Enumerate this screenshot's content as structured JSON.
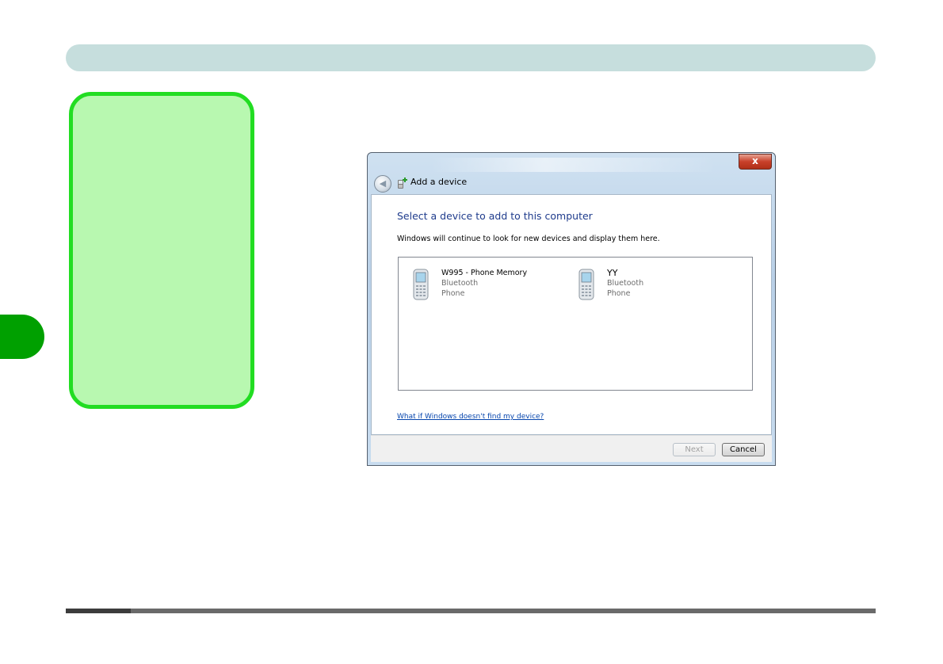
{
  "dialog": {
    "title": "Add a device",
    "close_label": "x",
    "heading": "Select a device to add to this computer",
    "subtext": "Windows will continue to look for new devices and display them here.",
    "devices": [
      {
        "name": "W995 - Phone Memory",
        "connection": "Bluetooth",
        "category": "Phone"
      },
      {
        "name": "YY",
        "connection": "Bluetooth",
        "category": "Phone"
      }
    ],
    "help_link": "What if Windows doesn't find my device?",
    "next_label": "Next",
    "cancel_label": "Cancel"
  },
  "colors": {
    "header_bar": "#c6dedd",
    "note_fill": "#b8f8b0",
    "note_border": "#22dd22",
    "side_tab": "#00a000",
    "heading_text": "#1e3b8c",
    "link": "#0645ad"
  },
  "icons": {
    "back": "back-arrow-icon",
    "title": "bluetooth-device-icon",
    "device": "mobile-phone-icon",
    "close": "close-icon"
  }
}
